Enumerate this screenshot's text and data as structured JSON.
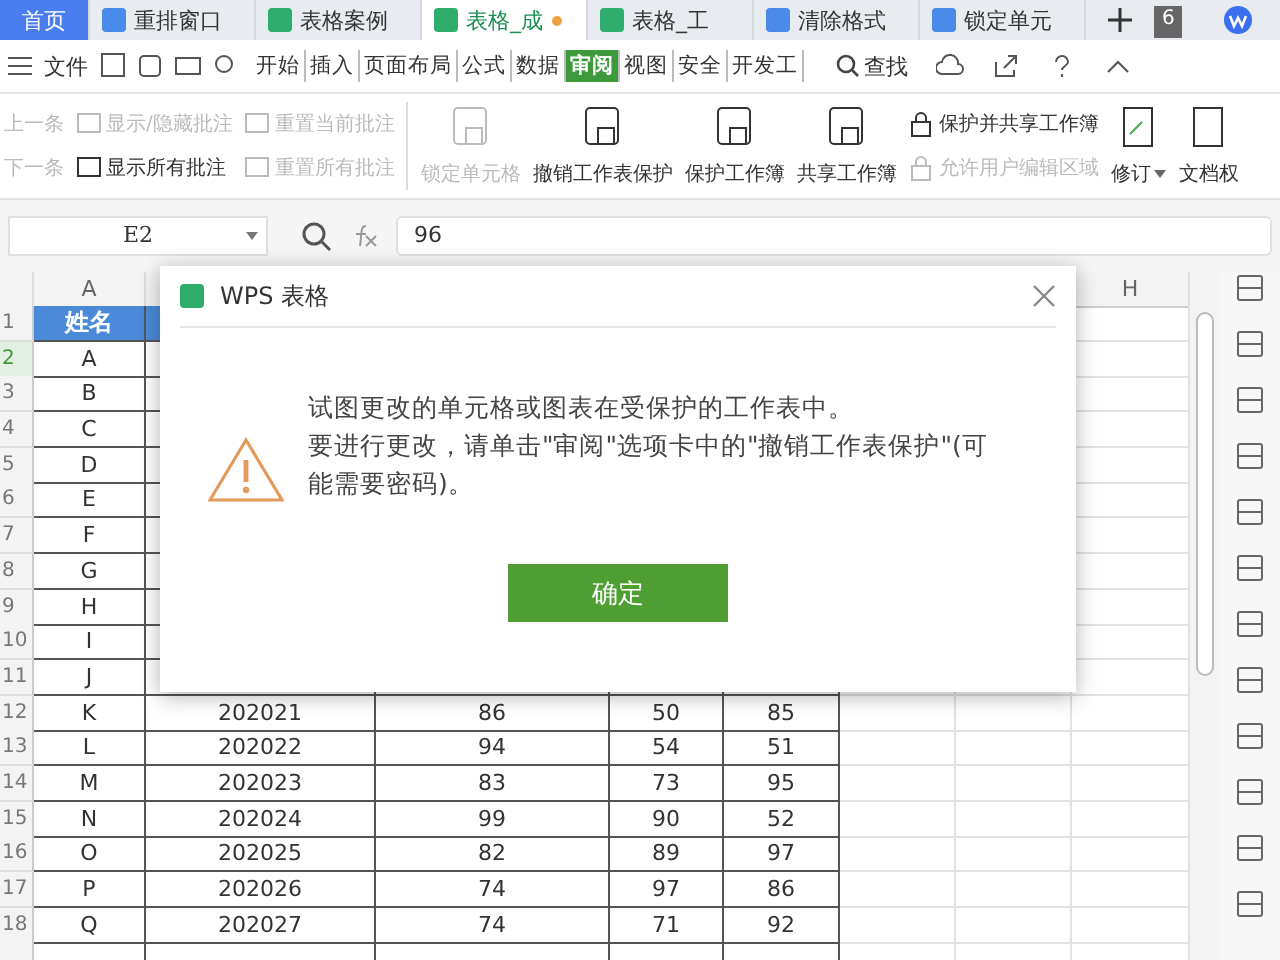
{
  "tabs": [
    {
      "label": "首页",
      "kind": "home",
      "selected": false,
      "modified": false
    },
    {
      "label": "重排窗口",
      "kind": "writer",
      "selected": false,
      "modified": false
    },
    {
      "label": "表格案例",
      "kind": "sheet",
      "selected": false,
      "modified": false
    },
    {
      "label": "表格_成",
      "kind": "sheet",
      "selected": true,
      "modified": true
    },
    {
      "label": "表格_工",
      "kind": "sheet",
      "selected": false,
      "modified": false
    },
    {
      "label": "清除格式",
      "kind": "writer",
      "selected": false,
      "modified": false
    },
    {
      "label": "锁定单元",
      "kind": "writer",
      "selected": false,
      "modified": false
    }
  ],
  "tab_count": "6",
  "menu": {
    "file": "文件",
    "items": [
      {
        "label": "开始",
        "selected": false
      },
      {
        "label": "插入",
        "selected": false
      },
      {
        "label": "页面布局",
        "selected": false
      },
      {
        "label": "公式",
        "selected": false
      },
      {
        "label": "数据",
        "selected": false
      },
      {
        "label": "审阅",
        "selected": true
      },
      {
        "label": "视图",
        "selected": false
      },
      {
        "label": "安全",
        "selected": false
      },
      {
        "label": "开发工",
        "selected": false
      }
    ],
    "search": "查找"
  },
  "ribbon": {
    "small_left": [
      {
        "label": "上一条",
        "disabled": true
      },
      {
        "label": "下一条",
        "disabled": true
      }
    ],
    "comment_tools": [
      {
        "label": "显示/隐藏批注",
        "disabled": true
      },
      {
        "label": "显示所有批注",
        "disabled": false
      },
      {
        "label": "重置当前批注",
        "disabled": true
      },
      {
        "label": "重置所有批注",
        "disabled": true
      }
    ],
    "big": [
      {
        "label": "锁定单元格",
        "disabled": true
      },
      {
        "label": "撤销工作表保护",
        "disabled": false
      },
      {
        "label": "保护工作簿",
        "disabled": false
      },
      {
        "label": "共享工作簿",
        "disabled": false
      }
    ],
    "small_right": [
      {
        "label": "保护并共享工作簿",
        "disabled": false
      },
      {
        "label": "允许用户编辑区域",
        "disabled": true
      }
    ],
    "revise": "修订",
    "rights": "文档权"
  },
  "formula_bar": {
    "cell": "E2",
    "value": "96"
  },
  "sheet": {
    "column_headers": [
      "A",
      "H"
    ],
    "rows": [
      {
        "num": "1",
        "active": false,
        "cells": [
          "姓名"
        ]
      },
      {
        "num": "2",
        "active": true,
        "cells": [
          "A"
        ]
      },
      {
        "num": "3",
        "active": false,
        "cells": [
          "B"
        ]
      },
      {
        "num": "4",
        "active": false,
        "cells": [
          "C"
        ]
      },
      {
        "num": "5",
        "active": false,
        "cells": [
          "D"
        ]
      },
      {
        "num": "6",
        "active": false,
        "cells": [
          "E"
        ]
      },
      {
        "num": "7",
        "active": false,
        "cells": [
          "F"
        ]
      },
      {
        "num": "8",
        "active": false,
        "cells": [
          "G"
        ]
      },
      {
        "num": "9",
        "active": false,
        "cells": [
          "H"
        ]
      },
      {
        "num": "10",
        "active": false,
        "cells": [
          "I"
        ]
      },
      {
        "num": "11",
        "active": false,
        "cells": [
          "J"
        ]
      },
      {
        "num": "12",
        "active": false,
        "cells": [
          "K",
          "202021",
          "86",
          "50",
          "85"
        ]
      },
      {
        "num": "13",
        "active": false,
        "cells": [
          "L",
          "202022",
          "94",
          "54",
          "51"
        ]
      },
      {
        "num": "14",
        "active": false,
        "cells": [
          "M",
          "202023",
          "83",
          "73",
          "95"
        ]
      },
      {
        "num": "15",
        "active": false,
        "cells": [
          "N",
          "202024",
          "99",
          "90",
          "52"
        ]
      },
      {
        "num": "16",
        "active": false,
        "cells": [
          "O",
          "202025",
          "82",
          "89",
          "97"
        ]
      },
      {
        "num": "17",
        "active": false,
        "cells": [
          "P",
          "202026",
          "74",
          "97",
          "86"
        ]
      },
      {
        "num": "18",
        "active": false,
        "cells": [
          "Q",
          "202027",
          "74",
          "71",
          "92"
        ]
      }
    ]
  },
  "dialog": {
    "title": "WPS 表格",
    "lines": [
      "试图更改的单元格或图表在受保护的工作表中。",
      "要进行更改，请单击\"审阅\"选项卡中的\"撤销工作表保护\"(可能需要密码)。"
    ],
    "button": "确定"
  }
}
